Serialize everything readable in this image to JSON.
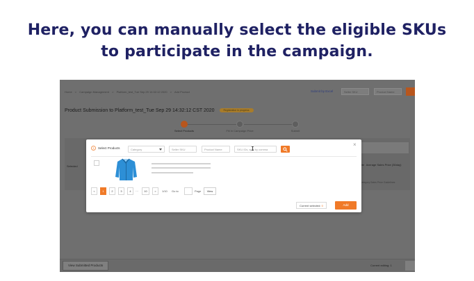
{
  "caption": {
    "line1": "Here, you can manually select the eligible SKUs",
    "line2": "to participate in the campaign."
  },
  "breadcrumb": [
    "Home",
    ">",
    "Campaign Management",
    ">",
    "Platform_test_Tue Sep 29 14:32:12 2020",
    ">",
    "Add Product"
  ],
  "topbar": {
    "submit_excel": "Submit by Excel",
    "seller_sku_placeholder": "Seller SKU",
    "product_name_placeholder": "Product Name"
  },
  "page": {
    "title": "Product Submission to Platform_test_Tue Sep 29 14:32:12 CST 2020",
    "badge": "Registration in progress"
  },
  "steps": [
    {
      "num": "1",
      "label": "Select Products",
      "active": true
    },
    {
      "num": "2",
      "label": "Fill In Campaign Price",
      "active": false
    },
    {
      "num": "3",
      "label": "Submit",
      "active": false
    }
  ],
  "background_table": {
    "left_col": "Selected",
    "ic": "ite",
    "right_col": "Average Sales Price (30day)",
    "note": "Category Sales Price Guidelines"
  },
  "bottombar": {
    "view_submitted": "View Submitted Products",
    "editing": "Current editing: 1"
  },
  "modal": {
    "step_num": "1",
    "select_label": "Select Products",
    "category_placeholder": "Category",
    "seller_sku_placeholder": "Seller SKU",
    "product_name_placeholder": "Product Name",
    "sku_ids_placeholder": "SKU IDs, split by comma",
    "close": "×",
    "pagination": {
      "pages": [
        "1",
        "2",
        "3",
        "4"
      ],
      "ellipsis": "···",
      "last": "10",
      "prev": "<",
      "next": ">",
      "page_info": "1/10",
      "goto": "Go to",
      "page_word": "Page",
      "view": "View"
    },
    "current_selected_label": "Current selected:",
    "current_selected_count": "0",
    "add_label": "Add"
  },
  "colors": {
    "accent": "#f07a28",
    "caption": "#1f2163",
    "overlay": "#6f6f6f",
    "product_jacket": "#2d8fd6"
  },
  "icons": [
    "search-icon",
    "close-icon",
    "chevron-down-icon",
    "text-cursor-icon",
    "jacket-image"
  ]
}
